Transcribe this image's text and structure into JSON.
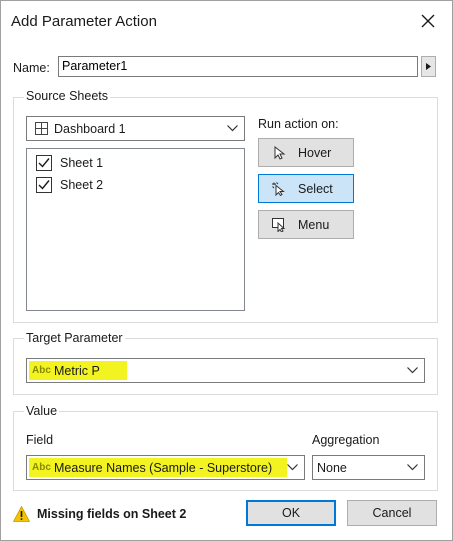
{
  "window": {
    "title": "Add Parameter Action"
  },
  "name_field": {
    "label": "Name:",
    "value": "Parameter1"
  },
  "source_sheets": {
    "title": "Source Sheets",
    "dashboard": "Dashboard 1",
    "sheets": [
      {
        "label": "Sheet 1",
        "checked": true
      },
      {
        "label": "Sheet 2",
        "checked": true
      }
    ],
    "run_action_label": "Run action on:",
    "actions": [
      {
        "label": "Hover",
        "icon": "pointer-icon",
        "selected": false
      },
      {
        "label": "Select",
        "icon": "select-pointer-icon",
        "selected": true
      },
      {
        "label": "Menu",
        "icon": "menu-icon",
        "selected": false
      }
    ]
  },
  "target_parameter": {
    "title": "Target Parameter",
    "type_badge": "Abc",
    "value": "Metric P"
  },
  "value_section": {
    "title": "Value",
    "field_label": "Field",
    "field_type_badge": "Abc",
    "field_value": "Measure Names (Sample - Superstore)",
    "aggregation_label": "Aggregation",
    "aggregation_value": "None"
  },
  "footer": {
    "warning": "Missing fields on Sheet 2",
    "ok_label": "OK",
    "cancel_label": "Cancel"
  },
  "colors": {
    "highlight": "#f2f20a",
    "selected_button": "#cce4f7",
    "focus_border": "#0078d7",
    "warning": "#f5c400"
  }
}
